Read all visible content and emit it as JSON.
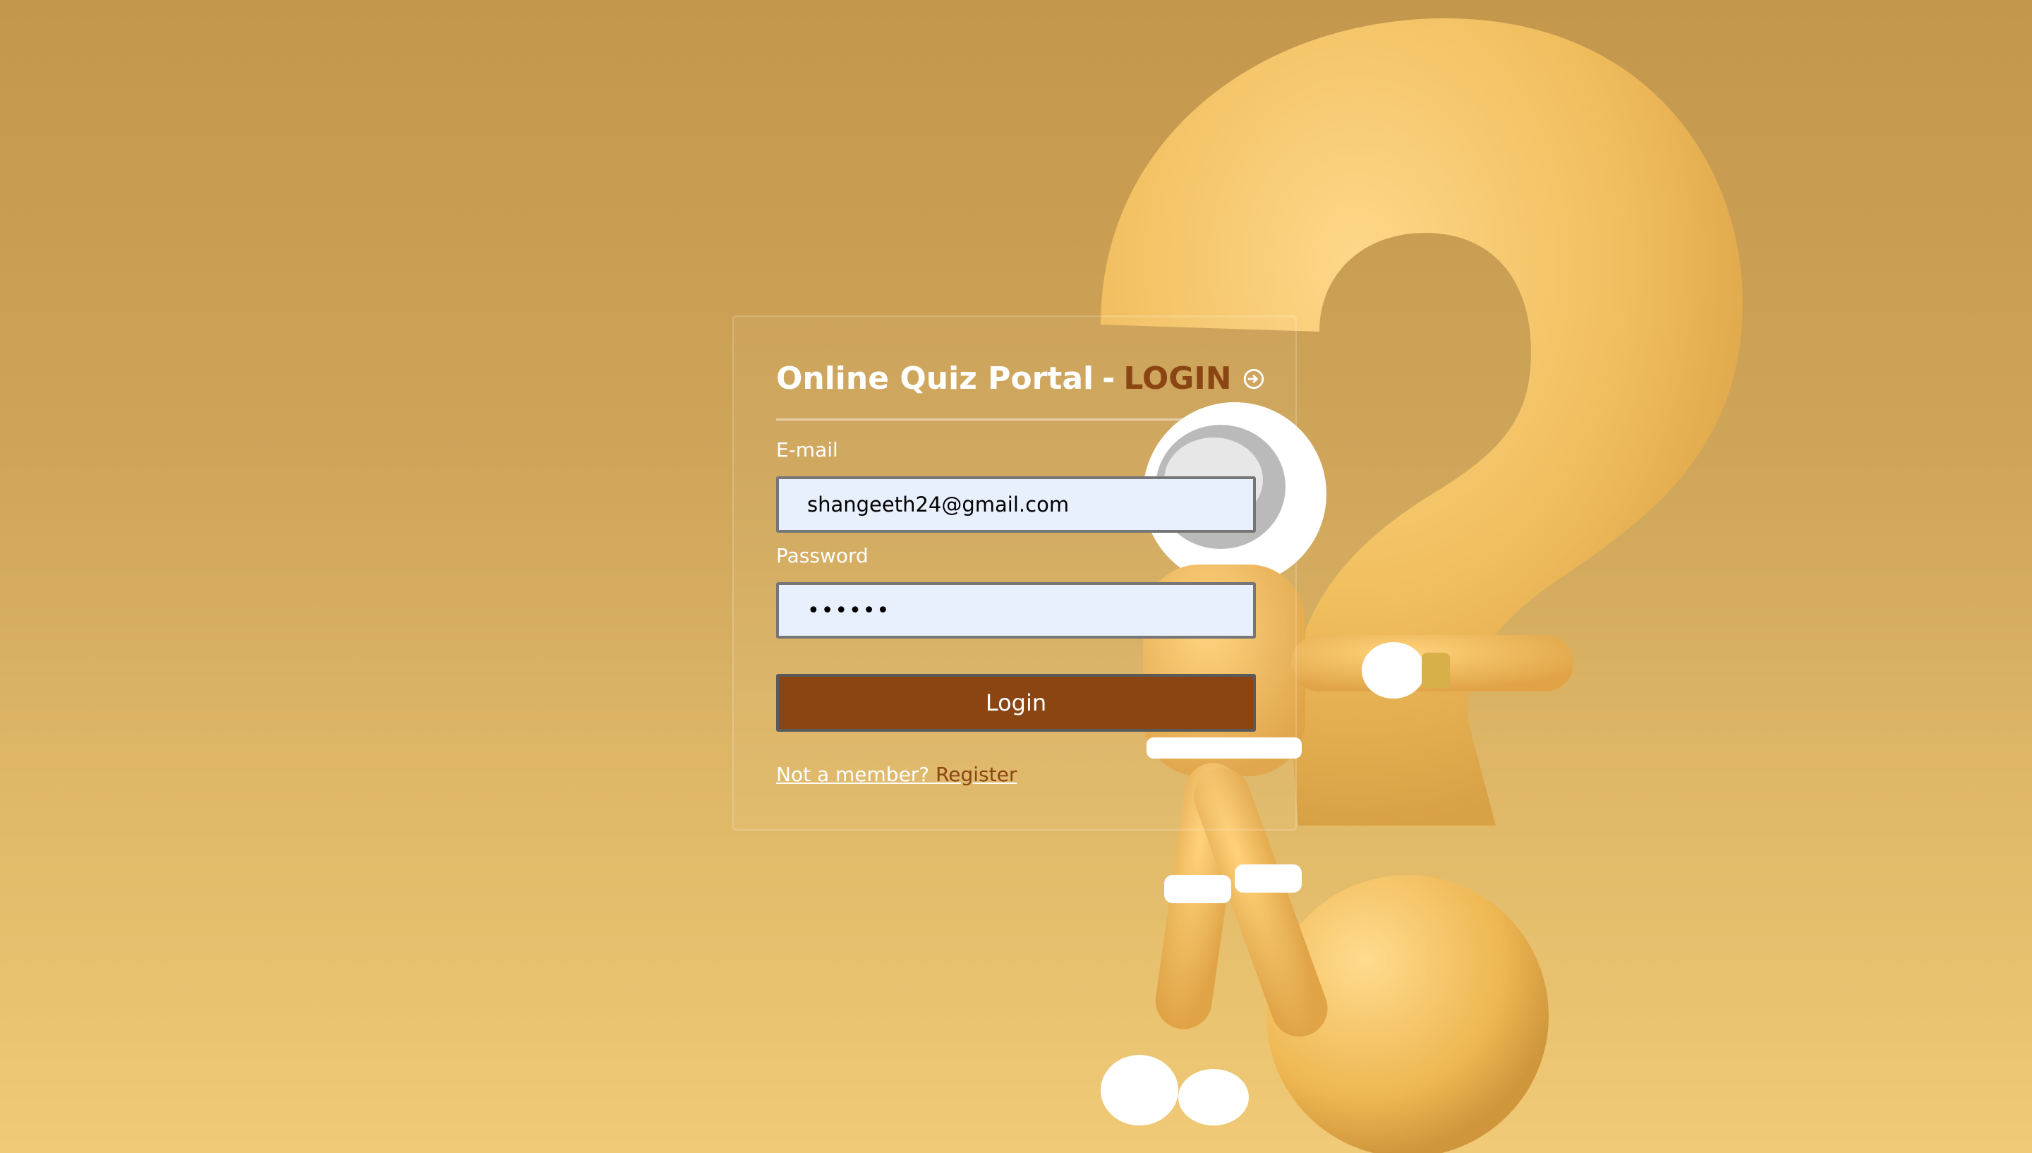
{
  "page": {
    "title_main": "Online Quiz Portal",
    "title_sep": "-",
    "title_accent": "LOGIN",
    "title_icon": "login-circle-icon"
  },
  "form": {
    "email_label": "E-mail",
    "email_value": "shangeeth24@gmail.com",
    "password_label": "Password",
    "password_value": "••••••",
    "login_button": "Login",
    "not_member": "Not a member?",
    "register_link": "Register"
  },
  "colors": {
    "accent": "#8b4513",
    "background": "#d4a95c",
    "input_bg": "#e8f0fe"
  },
  "background_art": "question-mark-astronaut-illustration"
}
